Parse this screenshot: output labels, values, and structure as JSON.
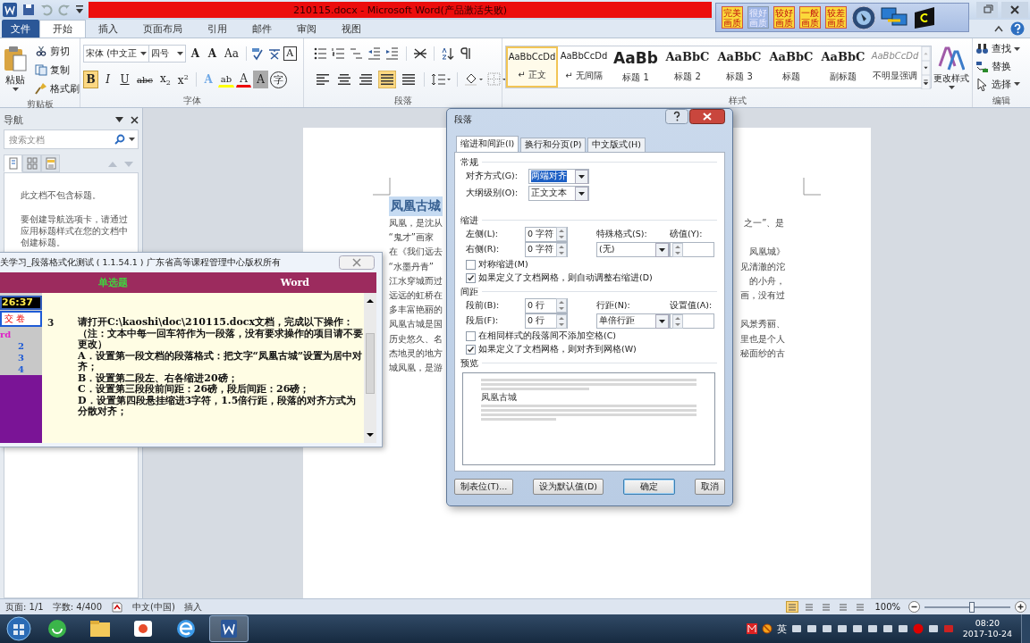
{
  "title_bar": {
    "title": "210115.docx - Microsoft Word(产品激活失败)"
  },
  "quality_toolbar": {
    "buttons": [
      {
        "label": "完美画质",
        "selected": false
      },
      {
        "label": "很好画质",
        "selected": true
      },
      {
        "label": "较好画质",
        "selected": false
      },
      {
        "label": "一般画质",
        "selected": false
      },
      {
        "label": "较差画质",
        "selected": false
      }
    ]
  },
  "ribbon_tabs": [
    {
      "label": "文件",
      "kind": "file",
      "selected": false
    },
    {
      "label": "开始",
      "kind": "tab",
      "selected": true
    },
    {
      "label": "插入",
      "kind": "tab",
      "selected": false
    },
    {
      "label": "页面布局",
      "kind": "tab",
      "selected": false
    },
    {
      "label": "引用",
      "kind": "tab",
      "selected": false
    },
    {
      "label": "邮件",
      "kind": "tab",
      "selected": false
    },
    {
      "label": "审阅",
      "kind": "tab",
      "selected": false
    },
    {
      "label": "视图",
      "kind": "tab",
      "selected": false
    }
  ],
  "clipboard": {
    "label": "剪贴板",
    "paste": "粘贴",
    "actions": [
      {
        "label": "剪切",
        "kind": "cut"
      },
      {
        "label": "复制",
        "kind": "copy"
      },
      {
        "label": "格式刷",
        "kind": "brush"
      }
    ]
  },
  "font": {
    "label": "字体",
    "name": "宋体 (中文正",
    "size": "四号",
    "size_buttons": [
      "A",
      "A",
      "Aa"
    ],
    "box_button": "A",
    "format_buttons": [
      {
        "label": "B",
        "kind": "bold",
        "selected": true
      },
      {
        "label": "I",
        "kind": "italic",
        "selected": false
      },
      {
        "label": "U",
        "kind": "underline",
        "selected": false
      },
      {
        "label": "abc",
        "kind": "strike",
        "selected": false
      },
      {
        "label": "x$_{2}$",
        "kind": "plain",
        "selected": false
      },
      {
        "label": "x$^{2}$",
        "kind": "plain",
        "selected": false
      },
      {
        "label": "A",
        "kind": "effect",
        "selected": false
      },
      {
        "label": "ab",
        "kind": "highlight",
        "selected": false
      },
      {
        "label": "A",
        "kind": "color",
        "selected": false
      },
      {
        "label": "A",
        "kind": "shade",
        "selected": false
      },
      {
        "label": "字",
        "kind": "circle",
        "selected": false
      }
    ]
  },
  "paragraph": {
    "label": "段落",
    "align_buttons": [
      {
        "kind": "left",
        "selected": false
      },
      {
        "kind": "center",
        "selected": false
      },
      {
        "kind": "right",
        "selected": false
      },
      {
        "kind": "justify",
        "selected": true
      },
      {
        "kind": "distributed",
        "selected": false
      }
    ]
  },
  "styles": {
    "label": "样式",
    "change_styles": "更改样式",
    "items": [
      {
        "sample": "AaBbCcDd",
        "name": "↵ 正文",
        "kind": "normal",
        "selected": true
      },
      {
        "sample": "AaBbCcDd",
        "name": "↵ 无间隔",
        "kind": "normal",
        "selected": false
      },
      {
        "sample": "AaBb",
        "name": "标题 1",
        "kind": "h1",
        "selected": false
      },
      {
        "sample": "AaBbC",
        "name": "标题 2",
        "kind": "h2",
        "selected": false
      },
      {
        "sample": "AaBbC",
        "name": "标题 3",
        "kind": "h2",
        "selected": false
      },
      {
        "sample": "AaBbC",
        "name": "标题",
        "kind": "h2",
        "selected": false
      },
      {
        "sample": "AaBbC",
        "name": "副标题",
        "kind": "h2",
        "selected": false
      },
      {
        "sample": "AaBbCcDd",
        "name": "不明显强调",
        "kind": "subtle",
        "selected": false
      }
    ]
  },
  "editing": {
    "label": "编辑",
    "items": [
      {
        "label": "查找",
        "kind": "find"
      },
      {
        "label": "替换",
        "kind": "replace"
      },
      {
        "label": "选择",
        "kind": "select"
      }
    ]
  },
  "navigation": {
    "title": "导航",
    "search": {
      "placeholder": "搜索文档"
    },
    "view_tabs": [
      {
        "kind": "pages",
        "selected": true
      },
      {
        "kind": "thumbs",
        "selected": false
      },
      {
        "kind": "results",
        "selected": false
      }
    ],
    "messages": [
      "此文档不包含标题。",
      "要创建导航选项卡，请通过应用标题样式在您的文档中创建标题。"
    ]
  },
  "document": {
    "heading": "凤凰古城",
    "lines": [
      {
        "left": "凤凰，是沈从",
        "right": "之一”、是"
      },
      {
        "left": "“鬼才”画家"
      },
      {
        "left": "在《我们远去",
        "right": "凤凰城》"
      },
      {
        "left": "“水墨丹青”",
        "right": "见清澈的沱"
      },
      {
        "left": "江水穿城而过",
        "right": "的小舟，"
      },
      {
        "left": "远远的虹桥在",
        "right": "画，没有过"
      },
      {
        "left": "多丰富艳丽的"
      },
      {
        "left": "凤凰古城是国",
        "right": "风景秀丽、"
      },
      {
        "left": "历史悠久、名",
        "right": "里也是个人"
      },
      {
        "left": "杰地灵的地方",
        "right": "秘面纱的古"
      },
      {
        "left": "城凤凰，是游"
      }
    ]
  },
  "exam_window": {
    "title": "关学习_段落格式化测试 ( 1.1.54.1 ) 广东省高等课程管理中心版权所有",
    "section": "单选题",
    "subject": "Word",
    "timer": "26:37",
    "submit": "交 卷",
    "nav": [
      {
        "label": "rd",
        "kind": "subject"
      },
      {
        "label": "2",
        "kind": "question"
      },
      {
        "label": "3",
        "kind": "question"
      },
      {
        "label": "4",
        "kind": "question"
      }
    ],
    "question_number": "3",
    "question_lines": [
      "请打开C:\\kaoshi\\doc\\210115.docx文档，完成以下操作：",
      "（注：文本中每一回车符作为一段落，没有要求操作的项目请不要更改）",
      "A．设置第一段文档的段落格式：把文字“凤凰古城”设置为居中对齐；",
      "B．设置第二段左、右各缩进20磅；",
      "C．设置第三段段前间距：26磅，段后间距：26磅；",
      "D．设置第四段悬挂缩进3字符，1.5倍行距，段落的对齐方式为分散对齐；"
    ]
  },
  "dialog": {
    "title": "段落",
    "tabs": [
      {
        "label": "缩进和间距(I)",
        "selected": true
      },
      {
        "label": "换行和分页(P)",
        "selected": false
      },
      {
        "label": "中文版式(H)",
        "selected": false
      }
    ],
    "general": {
      "heading": "常规",
      "alignment": {
        "label": "对齐方式(G):",
        "value": "两端对齐"
      },
      "outline": {
        "label": "大纲级别(O):",
        "value": "正文文本"
      }
    },
    "indent": {
      "heading": "缩进",
      "left": {
        "label": "左侧(L):",
        "value": "0 字符"
      },
      "right": {
        "label": "右侧(R):",
        "value": "0 字符"
      },
      "special": {
        "label": "特殊格式(S):",
        "value": "(无)"
      },
      "by": {
        "label": "磅值(Y):"
      },
      "checks": [
        {
          "label": "对称缩进(M)",
          "checked": false
        },
        {
          "label": "如果定义了文档网格，则自动调整右缩进(D)",
          "checked": true
        }
      ]
    },
    "spacing": {
      "heading": "间距",
      "before": {
        "label": "段前(B):",
        "value": "0 行"
      },
      "after": {
        "label": "段后(F):",
        "value": "0 行"
      },
      "line": {
        "label": "行距(N):",
        "value": "单倍行距"
      },
      "at": {
        "label": "设置值(A):"
      },
      "checks": [
        {
          "label": "在相同样式的段落间不添加空格(C)",
          "checked": false
        },
        {
          "label": "如果定义了文档网格，则对齐到网格(W)",
          "checked": true
        }
      ]
    },
    "preview": {
      "heading": "预览",
      "sample": "凤凰古城"
    },
    "buttons": [
      {
        "label": "制表位(T)...",
        "default": false
      },
      {
        "label": "设为默认值(D)",
        "default": false
      },
      {
        "label": "确定",
        "default": true
      },
      {
        "label": "取消",
        "default": false
      }
    ]
  },
  "status_bar": {
    "items": [
      "页面: 1/1",
      "字数: 4/400",
      "中文(中国)",
      "插入"
    ],
    "zoom": {
      "label": "100%",
      "level": 0.55
    }
  },
  "taskbar": {
    "tray_language": "英",
    "time": "08:20",
    "date": "2017-10-24"
  }
}
